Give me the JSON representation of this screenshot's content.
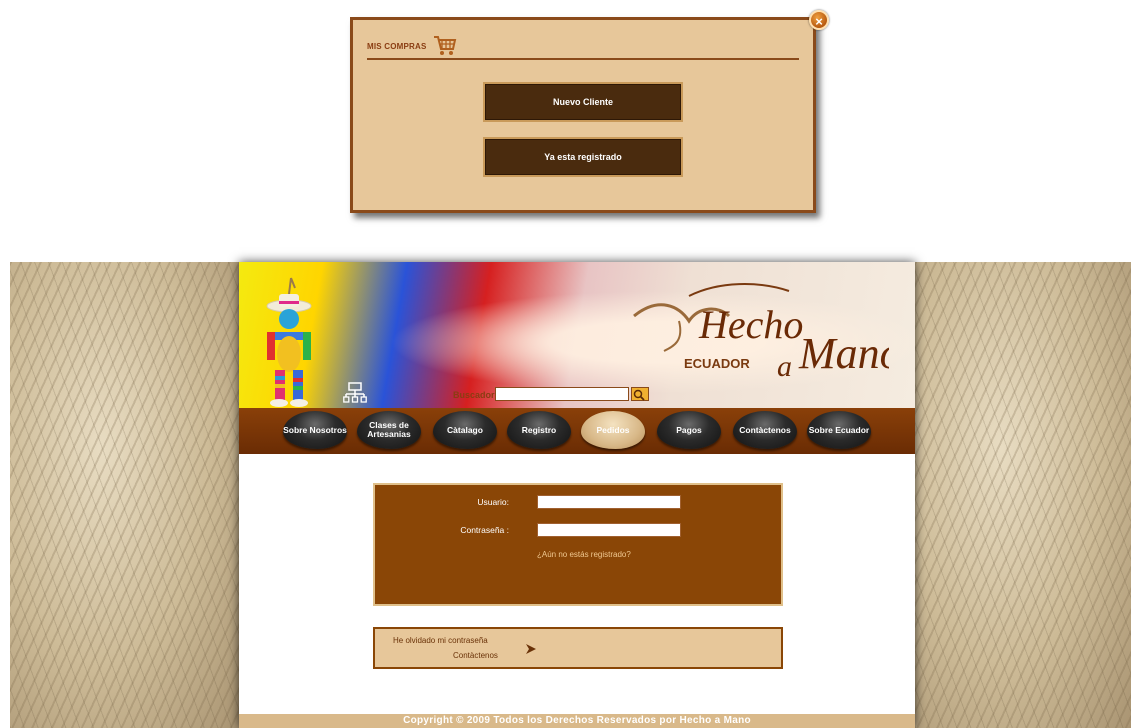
{
  "popup": {
    "title": "MIS COMPRAS",
    "cart_icon": "cart-icon",
    "close_icon": "close-icon",
    "close_glyph": "×",
    "buttons": {
      "new_client": "Nuevo Cliente",
      "registered": "Ya esta registrado"
    }
  },
  "header": {
    "logo_text": "Hecho a Mano",
    "logo_country": "ECUADOR",
    "search_label": "Buscador:",
    "search_value": "",
    "search_icon": "magnifier-icon",
    "sitemap_icon": "sitemap-icon"
  },
  "nav": {
    "items": [
      {
        "label": "Sobre Nosotros"
      },
      {
        "label": "Clases de Artesanias"
      },
      {
        "label": "Càtalago"
      },
      {
        "label": "Registro"
      },
      {
        "label": "Pedidos"
      },
      {
        "label": "Pagos"
      },
      {
        "label": "Contàctenos"
      },
      {
        "label": "Sobre Ecuador"
      }
    ],
    "active": "Pedidos"
  },
  "login": {
    "user_label": "Usuario:",
    "user_value": "",
    "password_label": "Contraseña :",
    "password_value": "",
    "register_link": "¿Aún no estás registrado?"
  },
  "help": {
    "forgot_password": "He olvidado mi contraseña",
    "contact": "Contàctenos",
    "arrow_icon": "arrow-right-icon"
  },
  "footer": {
    "copyright": "Copyright © 2009 Todos los Derechos Reservados por Hecho a Mano"
  },
  "colors": {
    "brown_dark": "#4a2b0e",
    "brown": "#8a4606",
    "tan": "#e7c79a",
    "accent_orange": "#d2701a"
  }
}
